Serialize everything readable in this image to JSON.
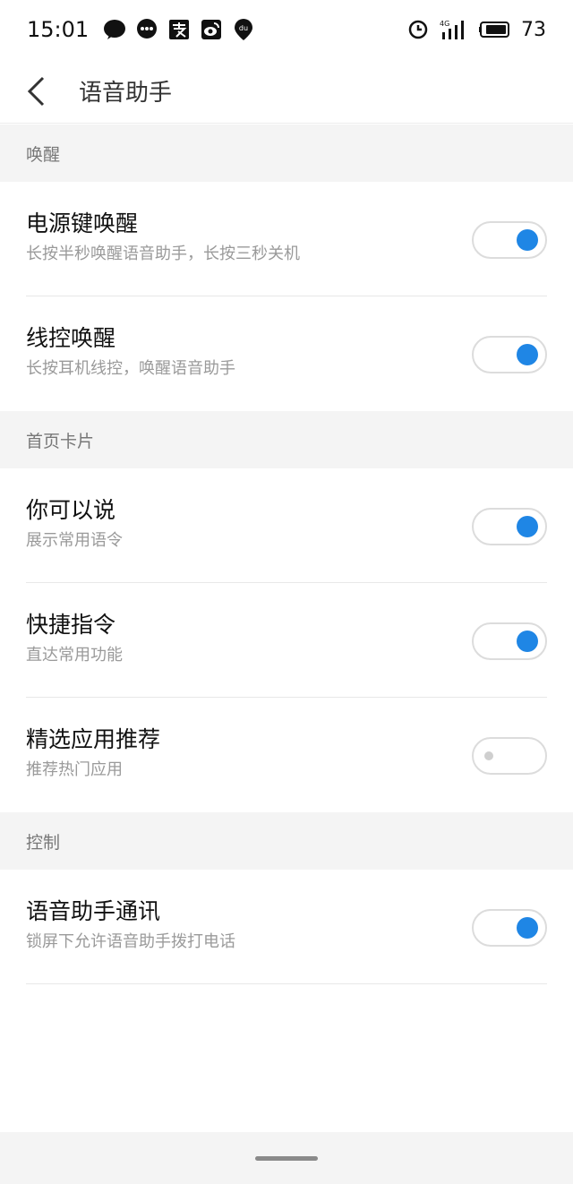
{
  "status_bar": {
    "time": "15:01",
    "icons": [
      "wechat-icon",
      "message-icon",
      "alipay-icon",
      "weibo-icon",
      "du-icon"
    ],
    "right_icons": [
      "alarm-icon",
      "signal-4g-icon",
      "battery-icon"
    ],
    "battery": "73",
    "network_badge": "4G"
  },
  "header": {
    "title": "语音助手"
  },
  "sections": [
    {
      "label": "唤醒",
      "items": [
        {
          "title": "电源键唤醒",
          "subtitle": "长按半秒唤醒语音助手，长按三秒关机",
          "enabled": true
        },
        {
          "title": "线控唤醒",
          "subtitle": "长按耳机线控，唤醒语音助手",
          "enabled": true
        }
      ]
    },
    {
      "label": "首页卡片",
      "items": [
        {
          "title": "你可以说",
          "subtitle": "展示常用语令",
          "enabled": true
        },
        {
          "title": "快捷指令",
          "subtitle": "直达常用功能",
          "enabled": true
        },
        {
          "title": "精选应用推荐",
          "subtitle": "推荐热门应用",
          "enabled": false
        }
      ]
    },
    {
      "label": "控制",
      "items": [
        {
          "title": "语音助手通讯",
          "subtitle": "锁屏下允许语音助手拨打电话",
          "enabled": true
        }
      ]
    }
  ],
  "colors": {
    "accent": "#1f86e5",
    "section_bg": "#f4f4f4"
  }
}
